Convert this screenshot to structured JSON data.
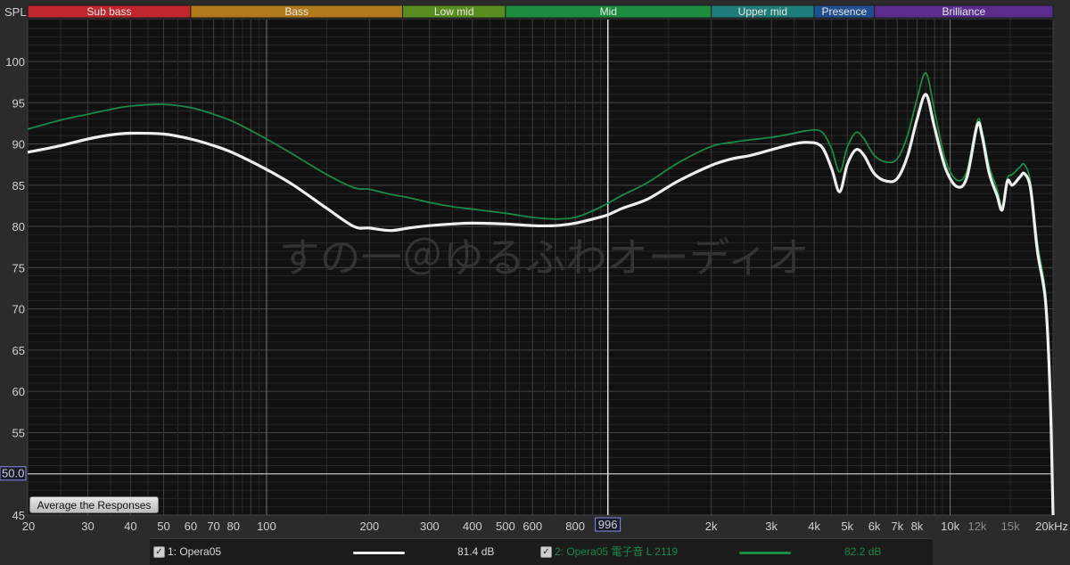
{
  "bands": [
    {
      "label": "Sub bass",
      "from": 20,
      "to": 60,
      "color": "#c0272d"
    },
    {
      "label": "Bass",
      "from": 60,
      "to": 250,
      "color": "#b07a1a"
    },
    {
      "label": "Low mid",
      "from": 250,
      "to": 500,
      "color": "#5a8d1f"
    },
    {
      "label": "Mid",
      "from": 500,
      "to": 2000,
      "color": "#1c8c3f"
    },
    {
      "label": "Upper mid",
      "from": 2000,
      "to": 4000,
      "color": "#1e7d78"
    },
    {
      "label": "Presence",
      "from": 4000,
      "to": 6000,
      "color": "#1f4f8f"
    },
    {
      "label": "Brilliance",
      "from": 6000,
      "to": 20000,
      "color": "#5a2d8c"
    }
  ],
  "chart_data": {
    "type": "line",
    "ylabel": "SPL",
    "ylim": [
      45,
      104
    ],
    "xlim": [
      20,
      20000
    ],
    "xscale": "log",
    "y_ticks": [
      45,
      50,
      55,
      60,
      65,
      70,
      75,
      80,
      85,
      90,
      95,
      100
    ],
    "x_tick_labels": [
      {
        "v": 20,
        "t": "20"
      },
      {
        "v": 30,
        "t": "30"
      },
      {
        "v": 40,
        "t": "40"
      },
      {
        "v": 50,
        "t": "50"
      },
      {
        "v": 60,
        "t": "60"
      },
      {
        "v": 70,
        "t": "70"
      },
      {
        "v": 80,
        "t": "80"
      },
      {
        "v": 100,
        "t": "100"
      },
      {
        "v": 200,
        "t": "200"
      },
      {
        "v": 300,
        "t": "300"
      },
      {
        "v": 400,
        "t": "400"
      },
      {
        "v": 500,
        "t": "500"
      },
      {
        "v": 600,
        "t": "600"
      },
      {
        "v": 800,
        "t": "800"
      },
      {
        "v": 2000,
        "t": "2k"
      },
      {
        "v": 3000,
        "t": "3k"
      },
      {
        "v": 4000,
        "t": "4k"
      },
      {
        "v": 5000,
        "t": "5k"
      },
      {
        "v": 6000,
        "t": "6k"
      },
      {
        "v": 7000,
        "t": "7k"
      },
      {
        "v": 8000,
        "t": "8k"
      },
      {
        "v": 10000,
        "t": "10k"
      },
      {
        "v": 12000,
        "t": "12k",
        "dim": true
      },
      {
        "v": 15000,
        "t": "15k",
        "dim": true
      },
      {
        "v": 20000,
        "t": "20kHz"
      }
    ],
    "cursor": {
      "freq": 996,
      "label": "996"
    },
    "reference_level": {
      "value": 50,
      "label": "50.0"
    },
    "grid": true,
    "watermark": "すの一＠ゆるふわオーディオ",
    "series": [
      {
        "name": "1: Opera05",
        "color": "#eeeeee",
        "points": [
          [
            20,
            89.0
          ],
          [
            25,
            89.8
          ],
          [
            30,
            90.6
          ],
          [
            35,
            91.1
          ],
          [
            40,
            91.3
          ],
          [
            50,
            91.2
          ],
          [
            60,
            90.6
          ],
          [
            70,
            89.8
          ],
          [
            80,
            88.9
          ],
          [
            100,
            86.9
          ],
          [
            120,
            85.0
          ],
          [
            150,
            82.2
          ],
          [
            180,
            80.0
          ],
          [
            200,
            79.8
          ],
          [
            230,
            79.5
          ],
          [
            260,
            79.8
          ],
          [
            300,
            80.1
          ],
          [
            350,
            80.3
          ],
          [
            400,
            80.4
          ],
          [
            500,
            80.3
          ],
          [
            600,
            80.1
          ],
          [
            700,
            80.1
          ],
          [
            800,
            80.4
          ],
          [
            900,
            80.9
          ],
          [
            996,
            81.4
          ],
          [
            1100,
            82.2
          ],
          [
            1300,
            83.3
          ],
          [
            1600,
            85.5
          ],
          [
            2000,
            87.4
          ],
          [
            2300,
            88.2
          ],
          [
            2600,
            88.6
          ],
          [
            3000,
            89.3
          ],
          [
            3400,
            89.9
          ],
          [
            3800,
            90.2
          ],
          [
            4200,
            89.7
          ],
          [
            4500,
            87.0
          ],
          [
            4750,
            84.2
          ],
          [
            5000,
            87.5
          ],
          [
            5300,
            89.3
          ],
          [
            5600,
            88.6
          ],
          [
            6000,
            86.4
          ],
          [
            6500,
            85.5
          ],
          [
            7000,
            85.8
          ],
          [
            7500,
            88.5
          ],
          [
            8000,
            93.0
          ],
          [
            8500,
            96.0
          ],
          [
            9000,
            92.0
          ],
          [
            9700,
            87.0
          ],
          [
            10500,
            84.8
          ],
          [
            11200,
            86.0
          ],
          [
            12000,
            92.3
          ],
          [
            12400,
            91.0
          ],
          [
            13000,
            86.5
          ],
          [
            13700,
            83.8
          ],
          [
            14200,
            82.0
          ],
          [
            14700,
            85.5
          ],
          [
            15200,
            85.0
          ],
          [
            16000,
            86.0
          ],
          [
            16500,
            86.4
          ],
          [
            17200,
            84.5
          ],
          [
            18000,
            77.0
          ],
          [
            19000,
            71.0
          ],
          [
            19600,
            60.0
          ],
          [
            20000,
            45.0
          ]
        ]
      },
      {
        "name": "2: Opera05 電子音 L 2119",
        "color": "#1a8a44",
        "points": [
          [
            20,
            91.8
          ],
          [
            25,
            92.9
          ],
          [
            30,
            93.6
          ],
          [
            35,
            94.2
          ],
          [
            40,
            94.6
          ],
          [
            50,
            94.8
          ],
          [
            60,
            94.4
          ],
          [
            70,
            93.6
          ],
          [
            80,
            92.7
          ],
          [
            100,
            90.6
          ],
          [
            120,
            88.7
          ],
          [
            150,
            86.3
          ],
          [
            180,
            84.7
          ],
          [
            200,
            84.5
          ],
          [
            230,
            83.9
          ],
          [
            260,
            83.5
          ],
          [
            300,
            82.9
          ],
          [
            350,
            82.4
          ],
          [
            400,
            82.1
          ],
          [
            500,
            81.6
          ],
          [
            600,
            81.1
          ],
          [
            700,
            80.9
          ],
          [
            800,
            81.1
          ],
          [
            900,
            81.9
          ],
          [
            996,
            82.8
          ],
          [
            1100,
            83.8
          ],
          [
            1300,
            85.3
          ],
          [
            1600,
            87.7
          ],
          [
            2000,
            89.7
          ],
          [
            2300,
            90.2
          ],
          [
            2600,
            90.5
          ],
          [
            3000,
            90.8
          ],
          [
            3400,
            91.2
          ],
          [
            3800,
            91.6
          ],
          [
            4200,
            91.5
          ],
          [
            4500,
            89.4
          ],
          [
            4750,
            86.6
          ],
          [
            5000,
            89.6
          ],
          [
            5300,
            91.4
          ],
          [
            5600,
            90.6
          ],
          [
            6000,
            88.6
          ],
          [
            6500,
            87.8
          ],
          [
            7000,
            88.2
          ],
          [
            7500,
            91.0
          ],
          [
            8000,
            95.5
          ],
          [
            8500,
            98.6
          ],
          [
            9000,
            94.0
          ],
          [
            9700,
            88.0
          ],
          [
            10500,
            85.6
          ],
          [
            11200,
            86.8
          ],
          [
            12000,
            92.8
          ],
          [
            12400,
            91.6
          ],
          [
            13000,
            87.4
          ],
          [
            13700,
            84.6
          ],
          [
            14200,
            82.4
          ],
          [
            14700,
            85.8
          ],
          [
            15200,
            86.3
          ],
          [
            16000,
            87.2
          ],
          [
            16500,
            87.5
          ],
          [
            17200,
            85.3
          ],
          [
            18000,
            78.0
          ],
          [
            19000,
            72.0
          ],
          [
            19600,
            62.0
          ],
          [
            20000,
            45.0
          ]
        ]
      }
    ]
  },
  "controls": {
    "average_button": "Average the Responses"
  },
  "legend": [
    {
      "check": "✓",
      "label": "1: Opera05",
      "value": "81.4 dB",
      "color": "#eeeeee"
    },
    {
      "check": "✓",
      "label": "2: Opera05 電子音 L 2119",
      "value": "82.2 dB",
      "color": "#1a8a44"
    }
  ]
}
